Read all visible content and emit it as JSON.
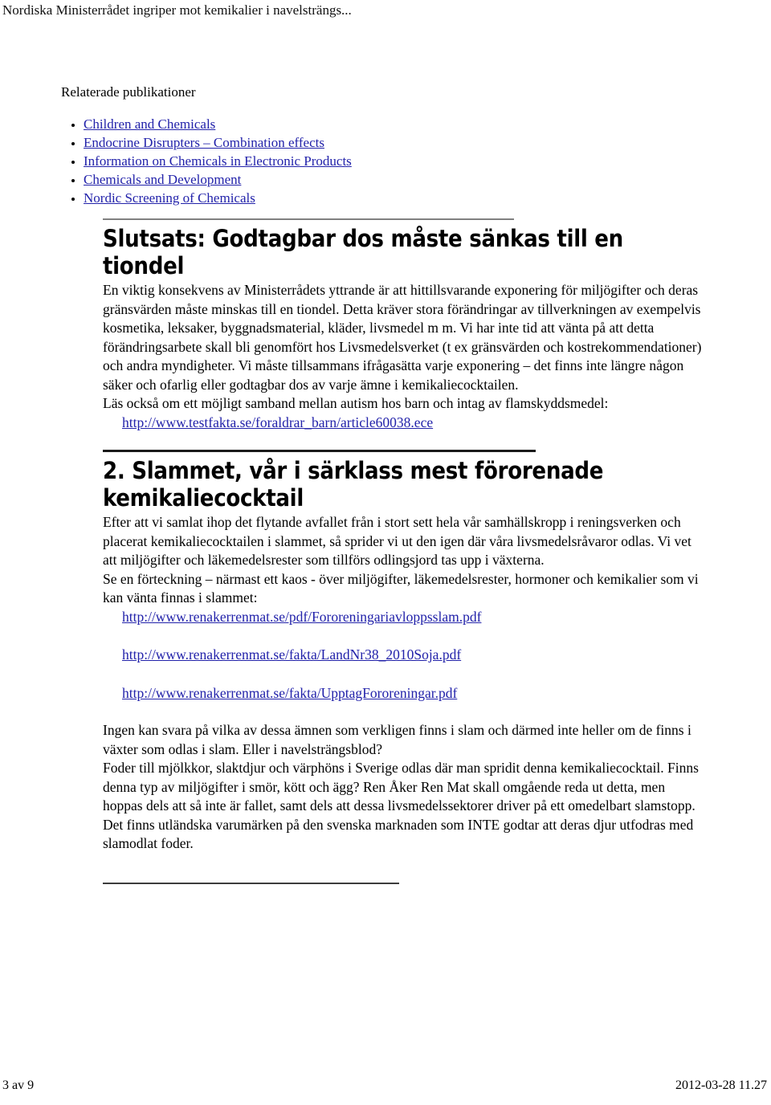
{
  "header": {
    "running_title": "Nordiska Ministerrådet ingriper mot kemikalier i navelsträngs..."
  },
  "related": {
    "label": "Relaterade publikationer",
    "items": [
      "Children and Chemicals",
      "Endocrine Disrupters – Combination effects",
      "Information on Chemicals in Electronic Products",
      "Chemicals and Development",
      "Nordic Screening of Chemicals"
    ]
  },
  "section1": {
    "heading": "Slutsats: Godtagbar dos måste sänkas till en tiondel",
    "paragraph1": "En viktig konsekvens av Ministerrådets yttrande är att hittillsvarande exponering för miljögifter och deras gränsvärden måste minskas till en tiondel. Detta kräver stora förändringar av tillverkningen av exempelvis kosmetika, leksaker, byggnadsmaterial, kläder, livsmedel m m. Vi har inte tid att vänta på att detta förändringsarbete skall bli genomfört hos Livsmedelsverket (t ex gränsvärden och kostrekommendationer) och andra myndigheter. Vi måste tillsammans ifrågasätta varje exponering – det finns inte längre någon säker och ofarlig eller godtagbar dos av varje ämne i kemikaliecocktailen.",
    "paragraph2": "Läs också om ett möjligt samband mellan autism hos barn och intag av flamskyddsmedel:",
    "link1": "http://www.testfakta.se/foraldrar_barn/article60038.ece"
  },
  "section2": {
    "heading": "2. Slammet, vår i särklass mest förorenade kemikaliecocktail",
    "paragraph1": "Efter att vi samlat ihop det flytande avfallet från i stort sett hela vår samhällskropp i reningsverken och placerat kemikaliecocktailen i slammet, så sprider vi ut den igen där våra livsmedelsråvaror odlas. Vi vet att miljögifter och läkemedelsrester som tillförs odlingsjord tas upp i växterna.",
    "paragraph2": "Se en förteckning – närmast ett kaos - över miljögifter, läkemedelsrester, hormoner och kemikalier som vi kan vänta finnas i slammet:",
    "link1": "http://www.renakerrenmat.se/pdf/Fororeningariavloppsslam.pdf",
    "link2": "http://www.renakerrenmat.se/fakta/LandNr38_2010Soja.pdf",
    "link3": "http://www.renakerrenmat.se/fakta/UpptagFororeningar.pdf",
    "paragraph3": "Ingen kan svara på vilka av dessa ämnen som verkligen finns i slam och därmed inte heller om de finns i växter som odlas i slam. Eller i navelsträngsblod?",
    "paragraph4": "Foder till mjölkkor, slaktdjur och värphöns i Sverige odlas där man spridit denna kemikaliecocktail. Finns denna typ av miljögifter i smör, kött och ägg? Ren Åker Ren Mat skall omgående reda ut detta, men hoppas dels att så inte är fallet, samt dels att dessa livsmedelssektorer driver på ett omedelbart slamstopp. Det finns utländska varumärken på den svenska marknaden som INTE godtar att deras djur utfodras med slamodlat foder."
  },
  "footer": {
    "page_number": "3 av 9",
    "timestamp": "2012-03-28 11.27"
  },
  "colors": {
    "link": "#2222aa",
    "text": "#000000",
    "rule_gray": "#808080",
    "rule_dark": "#1a1a1a"
  }
}
